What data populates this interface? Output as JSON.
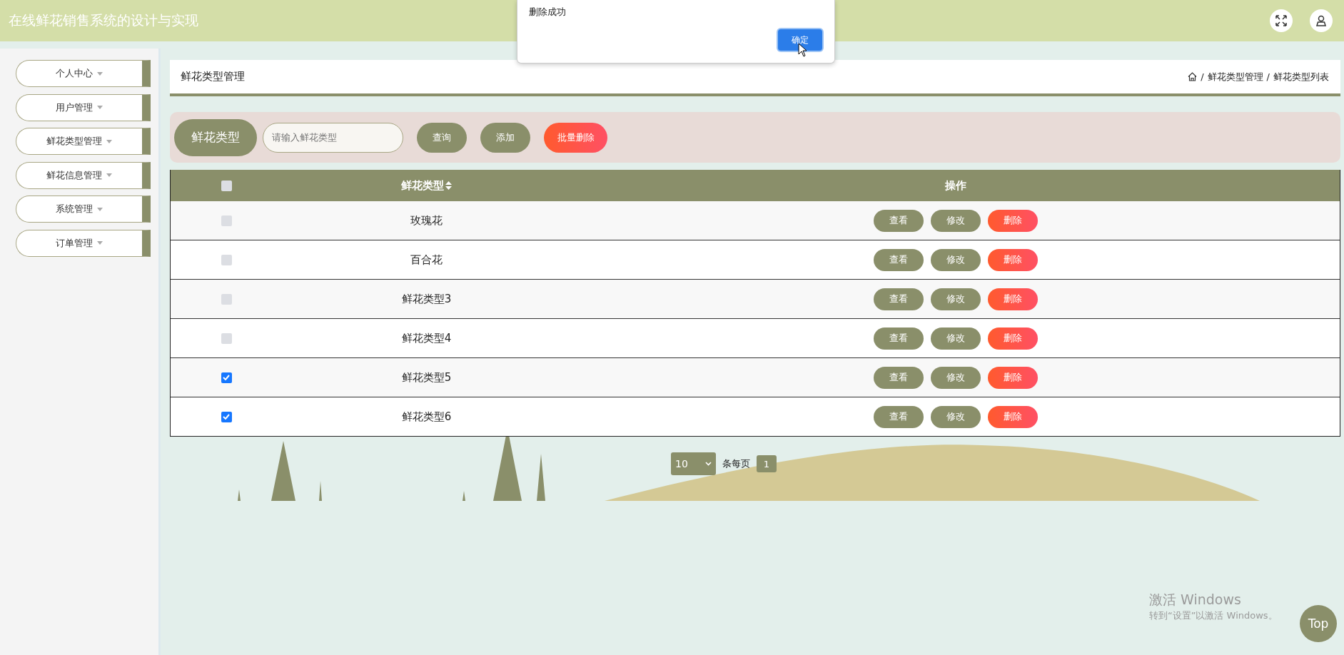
{
  "header": {
    "title": "在线鲜花销售系统的设计与实现"
  },
  "dialog": {
    "message": "删除成功",
    "confirm": "确定"
  },
  "sidebar": {
    "items": [
      {
        "label": "个人中心"
      },
      {
        "label": "用户管理"
      },
      {
        "label": "鲜花类型管理"
      },
      {
        "label": "鲜花信息管理"
      },
      {
        "label": "系统管理"
      },
      {
        "label": "订单管理"
      }
    ]
  },
  "page_title": "鲜花类型管理",
  "breadcrumb": {
    "items": [
      {
        "label": "鲜花类型管理",
        "separator": "/"
      },
      {
        "label": "鲜花类型列表",
        "separator": "/"
      }
    ]
  },
  "search": {
    "label": "鲜花类型",
    "placeholder": "请输入鲜花类型",
    "buttons": [
      {
        "label": "查询",
        "kind": "normal"
      },
      {
        "label": "添加",
        "kind": "normal"
      },
      {
        "label": "批量删除",
        "kind": "danger"
      }
    ]
  },
  "table": {
    "select_all": {
      "checked": false
    },
    "columns": [
      "鲜花类型",
      "操作"
    ],
    "rows": [
      {
        "checked": false,
        "type": "玫瑰花",
        "actions": [
          {
            "label": "查看",
            "kind": "normal"
          },
          {
            "label": "修改",
            "kind": "normal"
          },
          {
            "label": "删除",
            "kind": "danger"
          }
        ]
      },
      {
        "checked": false,
        "type": "百合花",
        "actions": [
          {
            "label": "查看",
            "kind": "normal"
          },
          {
            "label": "修改",
            "kind": "normal"
          },
          {
            "label": "删除",
            "kind": "danger"
          }
        ]
      },
      {
        "checked": false,
        "type": "鲜花类型3",
        "actions": [
          {
            "label": "查看",
            "kind": "normal"
          },
          {
            "label": "修改",
            "kind": "normal"
          },
          {
            "label": "删除",
            "kind": "danger"
          }
        ]
      },
      {
        "checked": false,
        "type": "鲜花类型4",
        "actions": [
          {
            "label": "查看",
            "kind": "normal"
          },
          {
            "label": "修改",
            "kind": "normal"
          },
          {
            "label": "删除",
            "kind": "danger"
          }
        ]
      },
      {
        "checked": true,
        "type": "鲜花类型5",
        "actions": [
          {
            "label": "查看",
            "kind": "normal"
          },
          {
            "label": "修改",
            "kind": "normal"
          },
          {
            "label": "删除",
            "kind": "danger"
          }
        ]
      },
      {
        "checked": true,
        "type": "鲜花类型6",
        "actions": [
          {
            "label": "查看",
            "kind": "normal"
          },
          {
            "label": "修改",
            "kind": "normal"
          },
          {
            "label": "删除",
            "kind": "danger"
          }
        ]
      }
    ]
  },
  "pagination": {
    "page_size": "10",
    "per_page_label": "条每页",
    "pages": [
      {
        "label": "1",
        "selected": true
      }
    ]
  },
  "os_notice": {
    "title": "激活 Windows",
    "text": "转到“设置”以激活 Windows。"
  },
  "top_button": "Top"
}
